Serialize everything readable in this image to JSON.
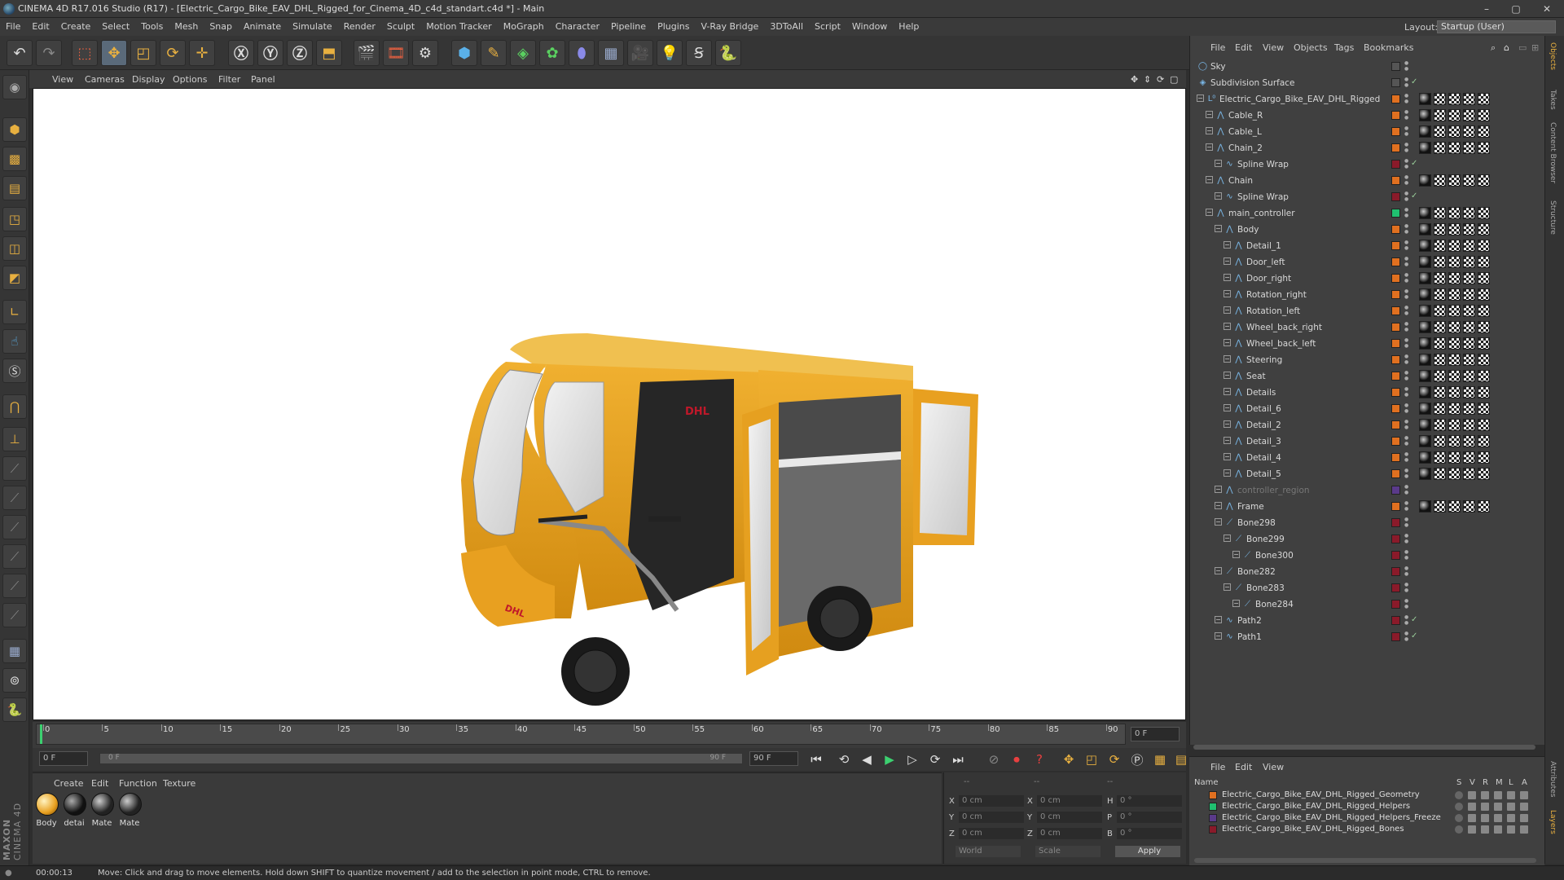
{
  "app": {
    "title": "CINEMA 4D R17.016 Studio (R17) - [Electric_Cargo_Bike_EAV_DHL_Rigged_for_Cinema_4D_c4d_standart.c4d *] - Main",
    "min": "–",
    "max": "▢",
    "close": "✕"
  },
  "menu": [
    "File",
    "Edit",
    "Create",
    "Select",
    "Tools",
    "Mesh",
    "Snap",
    "Animate",
    "Simulate",
    "Render",
    "Sculpt",
    "Motion Tracker",
    "MoGraph",
    "Character",
    "Pipeline",
    "Plugins",
    "V-Ray Bridge",
    "3DToAll",
    "Script",
    "Window",
    "Help"
  ],
  "layout": {
    "label": "Layout:",
    "value": "Startup (User)"
  },
  "toolbar": [
    "undo-icon",
    "redo-icon",
    "select-icon",
    "move-icon",
    "scale-icon",
    "rotate-icon",
    "live-select-icon",
    "x-axis-icon",
    "y-axis-icon",
    "z-axis-icon",
    "coord-system-icon",
    "render-view-icon",
    "render-picture-icon",
    "render-settings-icon",
    "cube-icon",
    "pen-icon",
    "subdiv-icon",
    "mograph-icon",
    "deformer-icon",
    "floor-icon",
    "camera-icon",
    "light-icon",
    "sculpt-icon",
    "python-icon"
  ],
  "viewport": {
    "menu": [
      "View",
      "Cameras",
      "Display",
      "Options",
      "Filter",
      "Panel"
    ]
  },
  "timeline": {
    "ticks": [
      "0",
      "5",
      "10",
      "15",
      "20",
      "25",
      "30",
      "35",
      "40",
      "45",
      "50",
      "55",
      "60",
      "65",
      "70",
      "75",
      "80",
      "85",
      "90"
    ],
    "current": "0 F",
    "start": "0 F",
    "range_start": "0 F",
    "range_end": "90 F",
    "end": "90 F"
  },
  "materials": {
    "menu": [
      "Create",
      "Edit",
      "Function",
      "Texture"
    ],
    "items": [
      {
        "label": "Body",
        "color": "#e8a020"
      },
      {
        "label": "detai",
        "color": "#222"
      },
      {
        "label": "Mate",
        "color": "#333"
      },
      {
        "label": "Mate",
        "color": "#333"
      }
    ]
  },
  "coords": {
    "x": "0 cm",
    "y": "0 cm",
    "z": "0 cm",
    "x2": "0 cm",
    "y2": "0 cm",
    "z2": "0 cm",
    "h": "0 °",
    "p": "0 °",
    "b": "0 °",
    "world": "World",
    "scale": "Scale",
    "apply": "Apply",
    "dash1": "--",
    "dash2": "--",
    "dash3": "--"
  },
  "status": {
    "time": "00:00:13",
    "message": "Move: Click and drag to move elements. Hold down SHIFT to quantize movement / add to the selection in point mode, CTRL to remove."
  },
  "objmgr": {
    "menu": [
      "File",
      "Edit",
      "View",
      "Objects",
      "Tags",
      "Bookmarks"
    ],
    "rows": [
      {
        "name": "Sky",
        "indent": 0,
        "layer": "#555",
        "icon": "◯"
      },
      {
        "name": "Subdivision Surface",
        "indent": 0,
        "layer": "#555",
        "icon": "◈"
      },
      {
        "name": "Electric_Cargo_Bike_EAV_DHL_Rigged",
        "indent": 1,
        "layer": "#e07020",
        "icon": "L⁰"
      },
      {
        "name": "Cable_R",
        "indent": 2,
        "layer": "#e07020",
        "icon": "⋀"
      },
      {
        "name": "Cable_L",
        "indent": 2,
        "layer": "#e07020",
        "icon": "⋀"
      },
      {
        "name": "Chain_2",
        "indent": 2,
        "layer": "#e07020",
        "icon": "⋀"
      },
      {
        "name": "Spline Wrap",
        "indent": 3,
        "layer": "#8a1a2a",
        "icon": "∿"
      },
      {
        "name": "Chain",
        "indent": 2,
        "layer": "#e07020",
        "icon": "⋀"
      },
      {
        "name": "Spline Wrap",
        "indent": 3,
        "layer": "#8a1a2a",
        "icon": "∿"
      },
      {
        "name": "main_controller",
        "indent": 2,
        "layer": "#20c070",
        "icon": "⋀"
      },
      {
        "name": "Body",
        "indent": 3,
        "layer": "#e07020",
        "icon": "⋀"
      },
      {
        "name": "Detail_1",
        "indent": 4,
        "layer": "#e07020",
        "icon": "⋀"
      },
      {
        "name": "Door_left",
        "indent": 4,
        "layer": "#e07020",
        "icon": "⋀"
      },
      {
        "name": "Door_right",
        "indent": 4,
        "layer": "#e07020",
        "icon": "⋀"
      },
      {
        "name": "Rotation_right",
        "indent": 4,
        "layer": "#e07020",
        "icon": "⋀"
      },
      {
        "name": "Rotation_left",
        "indent": 4,
        "layer": "#e07020",
        "icon": "⋀"
      },
      {
        "name": "Wheel_back_right",
        "indent": 4,
        "layer": "#e07020",
        "icon": "⋀"
      },
      {
        "name": "Wheel_back_left",
        "indent": 4,
        "layer": "#e07020",
        "icon": "⋀"
      },
      {
        "name": "Steering",
        "indent": 4,
        "layer": "#e07020",
        "icon": "⋀"
      },
      {
        "name": "Seat",
        "indent": 4,
        "layer": "#e07020",
        "icon": "⋀"
      },
      {
        "name": "Details",
        "indent": 4,
        "layer": "#e07020",
        "icon": "⋀"
      },
      {
        "name": "Detail_6",
        "indent": 4,
        "layer": "#e07020",
        "icon": "⋀"
      },
      {
        "name": "Detail_2",
        "indent": 4,
        "layer": "#e07020",
        "icon": "⋀"
      },
      {
        "name": "Detail_3",
        "indent": 4,
        "layer": "#e07020",
        "icon": "⋀"
      },
      {
        "name": "Detail_4",
        "indent": 4,
        "layer": "#e07020",
        "icon": "⋀"
      },
      {
        "name": "Detail_5",
        "indent": 4,
        "layer": "#e07020",
        "icon": "⋀"
      },
      {
        "name": "controller_region",
        "indent": 3,
        "layer": "#5a3a8a",
        "icon": "⋀",
        "dim": true
      },
      {
        "name": "Frame",
        "indent": 3,
        "layer": "#e07020",
        "icon": "⋀"
      },
      {
        "name": "Bone298",
        "indent": 3,
        "layer": "#8a1a2a",
        "icon": "⟋"
      },
      {
        "name": "Bone299",
        "indent": 4,
        "layer": "#8a1a2a",
        "icon": "⟋"
      },
      {
        "name": "Bone300",
        "indent": 5,
        "layer": "#8a1a2a",
        "icon": "⟋"
      },
      {
        "name": "Bone282",
        "indent": 3,
        "layer": "#8a1a2a",
        "icon": "⟋"
      },
      {
        "name": "Bone283",
        "indent": 4,
        "layer": "#8a1a2a",
        "icon": "⟋"
      },
      {
        "name": "Bone284",
        "indent": 5,
        "layer": "#8a1a2a",
        "icon": "⟋"
      },
      {
        "name": "Path2",
        "indent": 3,
        "layer": "#8a1a2a",
        "icon": "∿"
      },
      {
        "name": "Path1",
        "indent": 3,
        "layer": "#8a1a2a",
        "icon": "∿"
      }
    ]
  },
  "layermgr": {
    "menu": [
      "File",
      "Edit",
      "View"
    ],
    "header": {
      "name": "Name",
      "cols": [
        "S",
        "V",
        "R",
        "M",
        "L",
        "A"
      ]
    },
    "rows": [
      {
        "name": "Electric_Cargo_Bike_EAV_DHL_Rigged_Geometry",
        "color": "#e07020"
      },
      {
        "name": "Electric_Cargo_Bike_EAV_DHL_Rigged_Helpers",
        "color": "#20c070"
      },
      {
        "name": "Electric_Cargo_Bike_EAV_DHL_Rigged_Helpers_Freeze",
        "color": "#5a3a8a"
      },
      {
        "name": "Electric_Cargo_Bike_EAV_DHL_Rigged_Bones",
        "color": "#8a1a2a"
      }
    ]
  },
  "sidetabs": [
    "Objects",
    "Takes",
    "Content Browser",
    "Structure"
  ],
  "sidetabs2": [
    "Attributes",
    "Layers"
  ],
  "brand": {
    "maxon": "MAXON",
    "c4d": "CINEMA 4D"
  },
  "vehicle": {
    "logo_text": "DHL"
  }
}
